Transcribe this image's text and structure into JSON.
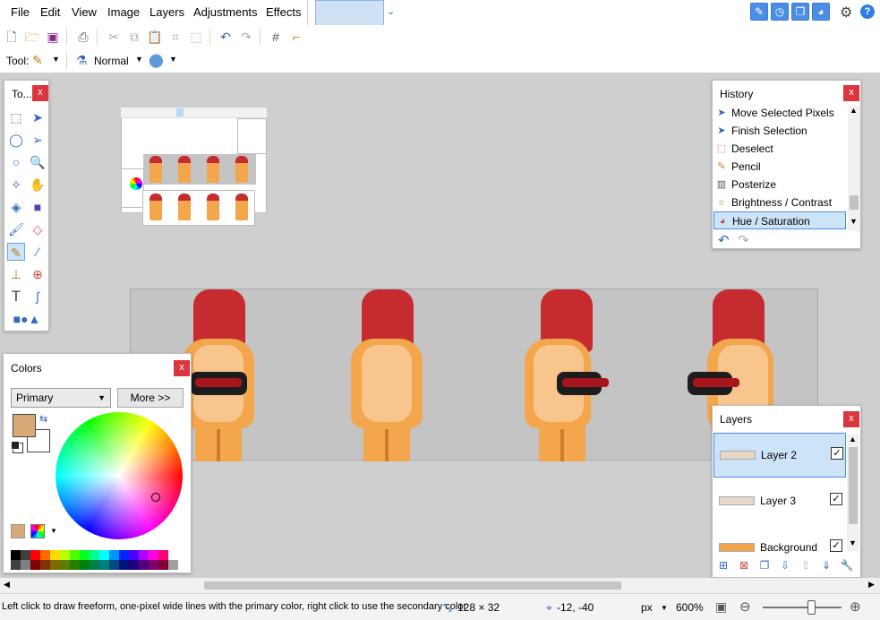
{
  "menu": {
    "file": "File",
    "edit": "Edit",
    "view": "View",
    "image": "Image",
    "layers": "Layers",
    "adjustments": "Adjustments",
    "effects": "Effects"
  },
  "tool_options": {
    "tool_label": "Tool:",
    "blend_mode": "Normal"
  },
  "tools_panel": {
    "title": "To...",
    "close": "x"
  },
  "history": {
    "title": "History",
    "close": "x",
    "items": [
      {
        "label": "Move Selected Pixels",
        "icon": "move-selection-icon"
      },
      {
        "label": "Finish Selection",
        "icon": "finish-selection-icon"
      },
      {
        "label": "Deselect",
        "icon": "deselect-icon"
      },
      {
        "label": "Pencil",
        "icon": "pencil-icon"
      },
      {
        "label": "Posterize",
        "icon": "posterize-icon"
      },
      {
        "label": "Brightness / Contrast",
        "icon": "brightness-icon"
      },
      {
        "label": "Hue / Saturation",
        "icon": "hue-saturation-icon"
      }
    ],
    "selected_index": 6
  },
  "colors": {
    "title": "Colors",
    "close": "x",
    "mode": "Primary",
    "more_label": "More >>",
    "primary_color": "#d9a877",
    "secondary_color": "#ffffff"
  },
  "layers": {
    "title": "Layers",
    "close": "x",
    "items": [
      {
        "name": "Layer 2",
        "visible": "✓"
      },
      {
        "name": "Layer 3",
        "visible": "✓"
      },
      {
        "name": "Background",
        "visible": "✓"
      }
    ],
    "selected_index": 0
  },
  "status": {
    "hint": "Left click to draw freeform, one-pixel wide lines with the primary color, right click to use the secondary color",
    "selection_size": "128 × 32",
    "cursor_position": "-12, -40",
    "units": "px",
    "zoom": "600%"
  },
  "colors_theme": {
    "accent": "#4a90e2",
    "close_red": "#d9373d",
    "selection_bg": "#cde3f8"
  }
}
